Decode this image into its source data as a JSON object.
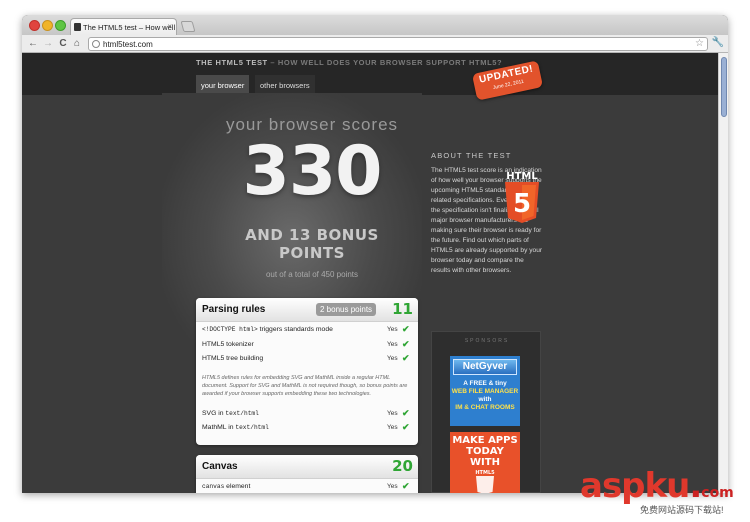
{
  "browser": {
    "tab_title": "The HTML5 test – How well",
    "tab_close": "×",
    "back": "←",
    "forward": "→",
    "reload": "C",
    "home": "⌂",
    "url": "html5test.com",
    "star": "☆",
    "wrench": "🔧"
  },
  "site": {
    "title_main": "THE HTML5 TEST",
    "title_sub": " – HOW WELL DOES YOUR BROWSER SUPPORT HTML5?",
    "nav": {
      "your_browser": "your browser",
      "other_browsers": "other browsers"
    },
    "badge": {
      "line1": "UPDATED!",
      "line2": "June 22, 2011"
    }
  },
  "score": {
    "heading": "your browser scores",
    "value": "330",
    "bonus_line1": "AND 13 BONUS",
    "bonus_line2": "POINTS",
    "out_of": "out of a total of 450 points"
  },
  "sections": {
    "parsing": {
      "title": "Parsing rules",
      "bonus": "2 bonus points",
      "score": "11",
      "rows": [
        {
          "mono": "<!DOCTYPE html>",
          "text": " triggers standards mode",
          "result": "Yes"
        },
        {
          "mono": "",
          "text": "HTML5 tokenizer",
          "result": "Yes"
        },
        {
          "mono": "",
          "text": "HTML5 tree building",
          "result": "Yes"
        }
      ],
      "note": "HTML5 defines rules for embedding SVG and MathML inside a regular HTML document. Support for SVG and MathML is not required though, so bonus points are awarded if your browser supports embedding these two technologies.",
      "bonus_rows": [
        {
          "text": "SVG in ",
          "mono": "text/html",
          "result": "Yes"
        },
        {
          "text": "MathML in ",
          "mono": "text/html",
          "result": "Yes"
        }
      ]
    },
    "canvas": {
      "title": "Canvas",
      "score": "20",
      "rows": [
        {
          "mono": "canvas",
          "text": " element",
          "result": "Yes"
        }
      ]
    }
  },
  "about": {
    "heading": "ABOUT THE TEST",
    "body": "The HTML5 test score is an indication of how well your browser supports the upcoming HTML5 standard and related specifications. Even though the specification isn't finalized yet, all major browser manufacturers are making sure their browser is ready for the future. Find out which parts of HTML5 are already supported by your browser today and compare the results with other browsers.",
    "logo_text": "HTML",
    "logo_number": "5"
  },
  "sponsors": {
    "label": "SPONSORS",
    "ad1": {
      "logo": "NetGyver",
      "line1": "A FREE & tiny",
      "line2": "WEB FILE MANAGER",
      "line3": "with",
      "line4": "IM & CHAT ROOMS"
    },
    "ad2": {
      "line1": "MAKE APPS",
      "line2": "TODAY WITH",
      "logo": "HTML5"
    }
  },
  "watermark": {
    "main": "aspku",
    "dot": ".",
    "com": "com",
    "sub": "免费网站源码下载站!"
  },
  "check_glyph": "✔",
  "colors": {
    "green": "#2fa534",
    "orange": "#e2532c",
    "html5_orange": "#e44d26"
  }
}
